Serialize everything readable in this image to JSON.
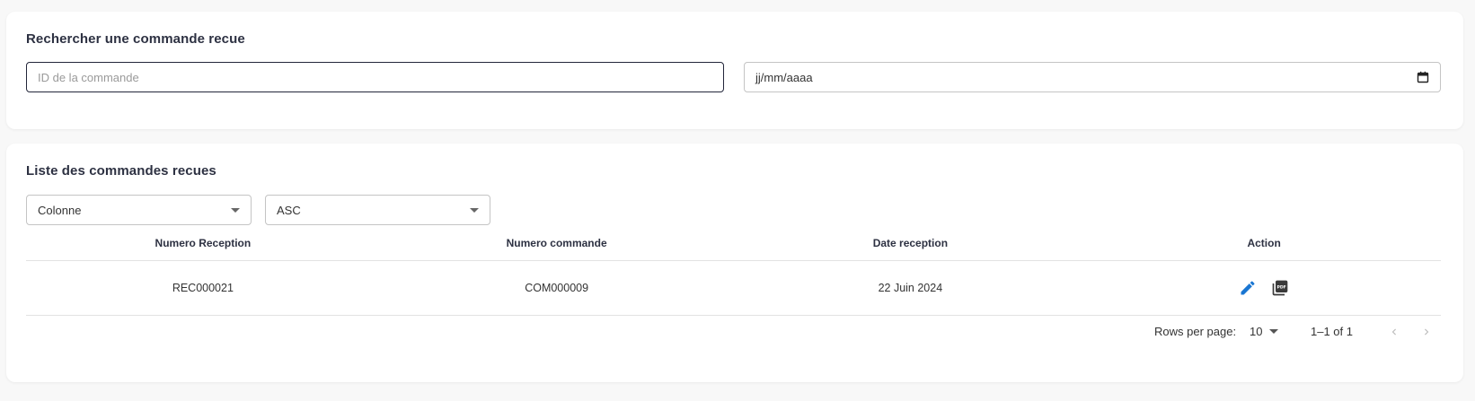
{
  "search": {
    "title": "Rechercher une commande recue",
    "id_placeholder": "ID de la commande",
    "date_placeholder": "jj/mm/aaaa",
    "date_icon": "calendar-icon"
  },
  "list": {
    "title": "Liste des commandes recues",
    "column_select": "Colonne",
    "order_select": "ASC",
    "columns": [
      "Numero Reception",
      "Numero commande",
      "Date reception",
      "Action"
    ],
    "rows": [
      {
        "numero_reception": "REC000021",
        "numero_commande": "COM000009",
        "date_reception": "22 Juin 2024",
        "actions": [
          "edit-icon",
          "pdf-icon"
        ]
      }
    ]
  },
  "pagination": {
    "rows_per_page_label": "Rows per page:",
    "rows_per_page_value": "10",
    "range": "1–1 of 1"
  },
  "colors": {
    "edit_icon": "#1976d2",
    "pdf_icon": "#3a3a3a",
    "focus_border": "#23263a"
  }
}
